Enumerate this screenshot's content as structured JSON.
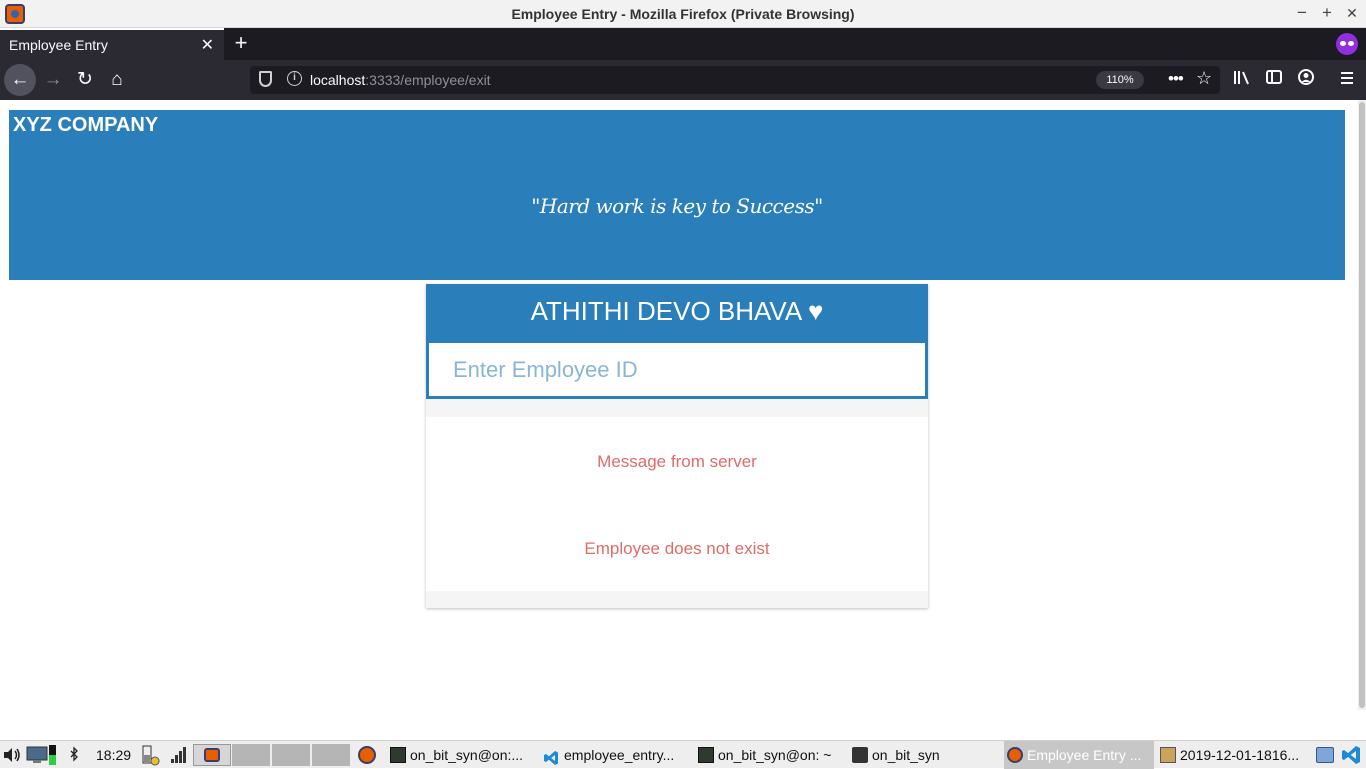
{
  "window": {
    "title": "Employee Entry - Mozilla Firefox (Private Browsing)",
    "controls": [
      "−",
      "+",
      "✕"
    ]
  },
  "tabs": [
    {
      "label": "Employee Entry",
      "close": "✕"
    }
  ],
  "newtab_label": "+",
  "nav": {
    "back": "←",
    "forward": "→",
    "reload": "↻",
    "home": "⌂",
    "url_host": "localhost",
    "url_rest": ":3333/employee/exit",
    "zoom": "110%",
    "more": "•••",
    "bookmark": "☆"
  },
  "page": {
    "company": "XYZ COMPANY",
    "slogan": "\"Hard work is key to Success\"",
    "greeting": "ATHITHI DEVO BHAVA",
    "heart": "♥",
    "employee_id": {
      "placeholder": "Enter Employee ID",
      "value": ""
    },
    "messages": [
      "Message from server",
      "Employee does not exist"
    ]
  },
  "taskbar": {
    "clock": "18:29",
    "tasks": [
      {
        "label": "on_bit_syn@on:...",
        "icon": "terminal-icon"
      },
      {
        "label": "employee_entry...",
        "icon": "vscode-icon"
      },
      {
        "label": "on_bit_syn@on: ~",
        "icon": "terminal-icon"
      },
      {
        "label": "on_bit_syn",
        "icon": "folder-icon"
      },
      {
        "label": "Employee Entry ...",
        "icon": "firefox-icon"
      },
      {
        "label": "2019-12-01-1816...",
        "icon": "image-viewer-icon"
      }
    ]
  },
  "colors": {
    "brand": "#2a7fba",
    "error_text": "#e06b6b",
    "placeholder": "#8ab6d6"
  }
}
